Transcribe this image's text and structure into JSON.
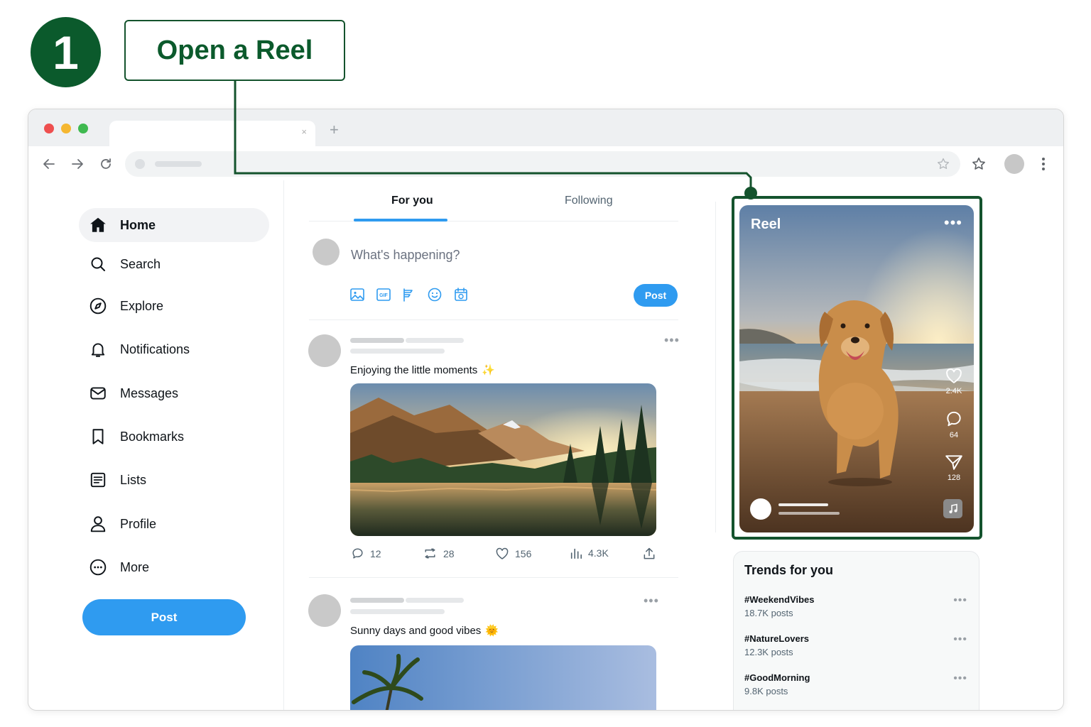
{
  "step": {
    "number": "1",
    "title": "Open a Reel"
  },
  "browser": {
    "tab_close": "×",
    "new_tab": "+"
  },
  "sidebar": {
    "items": [
      {
        "label": "Home",
        "icon": "home-icon"
      },
      {
        "label": "Search",
        "icon": "search-icon"
      },
      {
        "label": "Explore",
        "icon": "compass-icon"
      },
      {
        "label": "Notifications",
        "icon": "bell-icon"
      },
      {
        "label": "Messages",
        "icon": "mail-icon"
      },
      {
        "label": "Bookmarks",
        "icon": "bookmark-icon"
      },
      {
        "label": "Lists",
        "icon": "list-icon"
      },
      {
        "label": "Profile",
        "icon": "person-icon"
      },
      {
        "label": "More",
        "icon": "more-circle-icon"
      }
    ],
    "post_button": "Post"
  },
  "feed": {
    "tabs": [
      "For you",
      "Following"
    ],
    "active_tab": "For you",
    "compose": {
      "placeholder": "What's happening?",
      "post_button": "Post"
    },
    "posts": [
      {
        "text": "Enjoying the little moments",
        "emoji": "✨",
        "image": "mountain-lake-sunset",
        "actions": {
          "replies": "12",
          "reposts": "28",
          "likes": "156",
          "views": "4.3K"
        }
      },
      {
        "text": "Sunny days and good vibes",
        "emoji": "🌞",
        "image": "palm-tree-sky"
      }
    ]
  },
  "reel": {
    "title": "Reel",
    "more": "•••",
    "likes": "2.4K",
    "comments": "64",
    "shares": "128",
    "image": "golden-retriever-beach-sunset"
  },
  "trends": {
    "title": "Trends for you",
    "items": [
      {
        "tag": "#WeekendVibes",
        "count": "18.7K posts"
      },
      {
        "tag": "#NatureLovers",
        "count": "12.3K posts"
      },
      {
        "tag": "#GoodMorning",
        "count": "9.8K posts"
      }
    ],
    "more": "•••"
  },
  "colors": {
    "accent": "#2f9bf0",
    "step_green": "#0b5a2c",
    "highlight": "#14532d"
  }
}
